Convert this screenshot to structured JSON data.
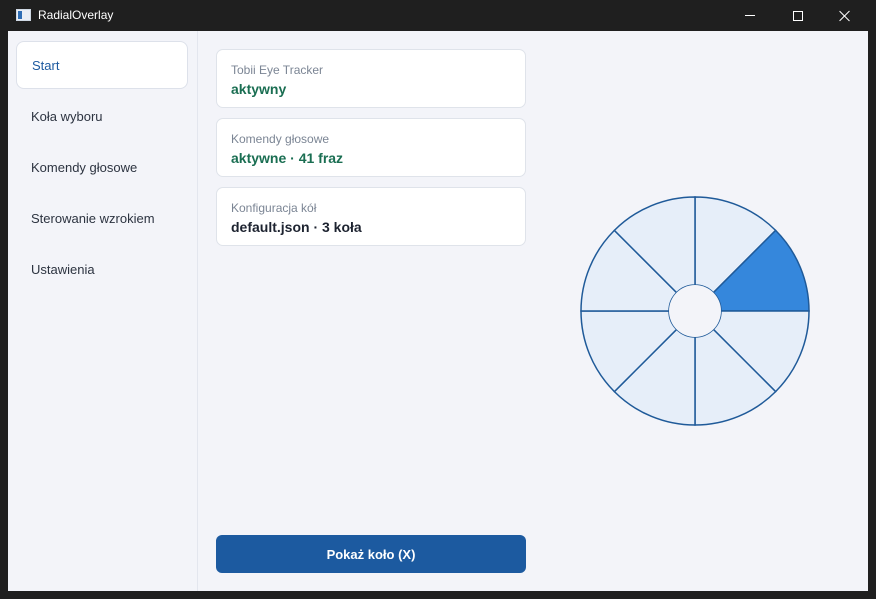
{
  "window": {
    "title": "RadialOverlay",
    "icon": "app-window-icon",
    "controls": [
      "minimize-icon",
      "maximize-icon",
      "close-icon"
    ]
  },
  "sidebar": {
    "items": [
      {
        "label": "Start",
        "active": true
      },
      {
        "label": "Koła wyboru",
        "active": false
      },
      {
        "label": "Komendy głosowe",
        "active": false
      },
      {
        "label": "Sterowanie wzrokiem",
        "active": false
      },
      {
        "label": "Ustawienia",
        "active": false
      }
    ]
  },
  "status_cards": [
    {
      "label": "Tobii Eye Tracker",
      "value": "aktywny",
      "value_color": "#1a6e52"
    },
    {
      "label": "Komendy głosowe",
      "value": "aktywne · 41 fraz",
      "value_color": "#1a6e52"
    },
    {
      "label": "Konfiguracja kół",
      "value": "default.json · 3 koła",
      "value_color": "#1d2330"
    }
  ],
  "main": {
    "show_button_label": "Pokaż koło (X)"
  },
  "wheel": {
    "segments": 8,
    "highlighted_segment": 1,
    "colors": {
      "segment_fill": "#e6eef9",
      "highlight_fill": "#3587dc",
      "stroke": "#1f5a99",
      "center": "#f3f4f9"
    }
  },
  "colors": {
    "accent": "#1c5aa0",
    "status_ok": "#1a6e52",
    "background": "#f3f4f9",
    "titlebar": "#1f1f1f"
  }
}
